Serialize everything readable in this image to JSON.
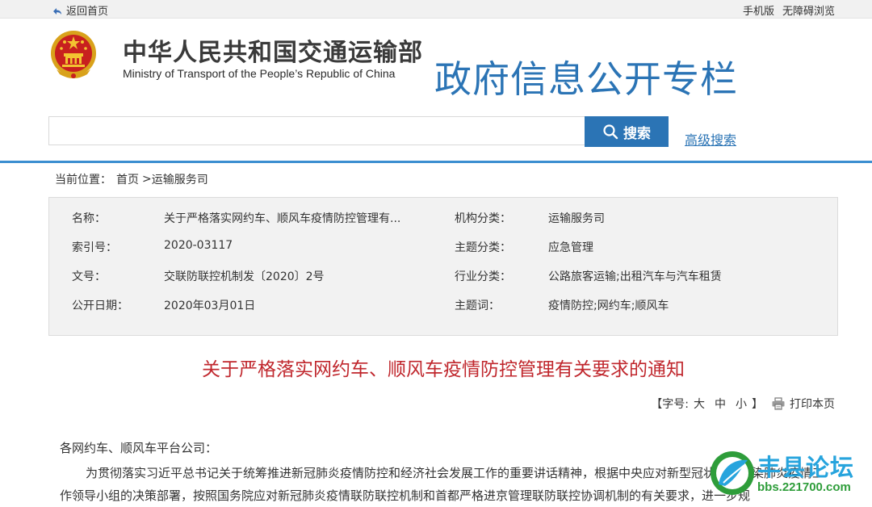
{
  "topbar": {
    "back_label": "返回首页",
    "mobile_label": "手机版",
    "accessible_label": "无障碍浏览"
  },
  "header": {
    "ministry_cn": "中华人民共和国交通运输部",
    "ministry_en": "Ministry of Transport of the People’s Republic of China",
    "column_title": "政府信息公开专栏"
  },
  "search": {
    "value": "",
    "button_label": "搜索",
    "advanced_label": "高级搜索"
  },
  "breadcrumb": {
    "label": "当前位置：",
    "home": "首页",
    "separator": ">",
    "current": "运输服务司"
  },
  "meta": {
    "name_label": "名称：",
    "name_value": "关于严格落实网约车、顺风车疫情防控管理有...",
    "index_label": "索引号：",
    "index_value": "2020-03117",
    "doc_no_label": "文号：",
    "doc_no_value": "交联防联控机制发〔2020〕2号",
    "date_label": "公开日期：",
    "date_value": "2020年03月01日",
    "org_label": "机构分类：",
    "org_value": "运输服务司",
    "topic_label": "主题分类：",
    "topic_value": "应急管理",
    "industry_label": "行业分类：",
    "industry_value": "公路旅客运输;出租汽车与汽车租赁",
    "keywords_label": "主题词：",
    "keywords_value": "疫情防控;网约车;顺风车"
  },
  "article": {
    "title": "关于严格落实网约车、顺风车疫情防控管理有关要求的通知",
    "greeting": "各网约车、顺风车平台公司：",
    "paragraph_1": "为贯彻落实习近平总书记关于统筹推进新冠肺炎疫情防控和经济社会发展工作的重要讲话精神，根据中央应对新型冠状病毒感染肺炎疫情工作领导小组的决策部署，按照国务院应对新冠肺炎疫情联防联控机制和首都严格进京管理联防联控协调机制的有关要求，进一步规"
  },
  "tools": {
    "font_size_prefix": "【字号:",
    "size_large": "大",
    "size_medium": "中",
    "size_small": "小",
    "font_size_suffix": "】",
    "print_label": "打印本页"
  },
  "watermark": {
    "title": "丰县论坛",
    "url": "bbs.221700.com"
  },
  "colors": {
    "accent_blue": "#2b74b5",
    "rule_blue": "#3b8ed0",
    "title_red": "#c0272d",
    "watermark_blue": "#27a4dd",
    "watermark_green": "#2e9d3a"
  }
}
